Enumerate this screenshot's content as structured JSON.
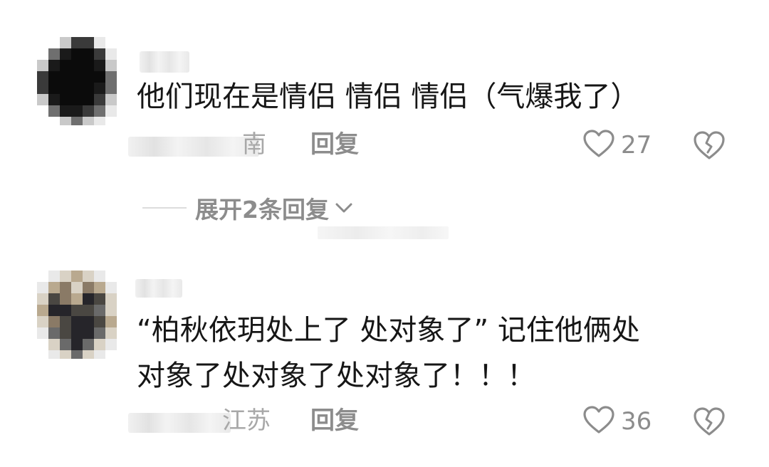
{
  "comments": [
    {
      "text_lines": [
        "他们现在是情侣 情侣 情侣（气爆我了）"
      ],
      "location_visible": "南",
      "reply_label": "回复",
      "like_count": "27",
      "expand_label": "展开2条回复"
    },
    {
      "text_lines": [
        "“柏秋依玥处上了 处对象了” 记住他俩处",
        "对象了处对象了处对象了！！！"
      ],
      "location_visible": "江苏",
      "reply_label": "回复",
      "like_count": "36"
    }
  ],
  "icons": {
    "like": "heart-outline-icon",
    "dislike": "broken-heart-icon",
    "expand": "chevron-down-icon"
  },
  "colors": {
    "text": "#161616",
    "muted": "#8c8c8c",
    "location": "#a8a8a8"
  }
}
